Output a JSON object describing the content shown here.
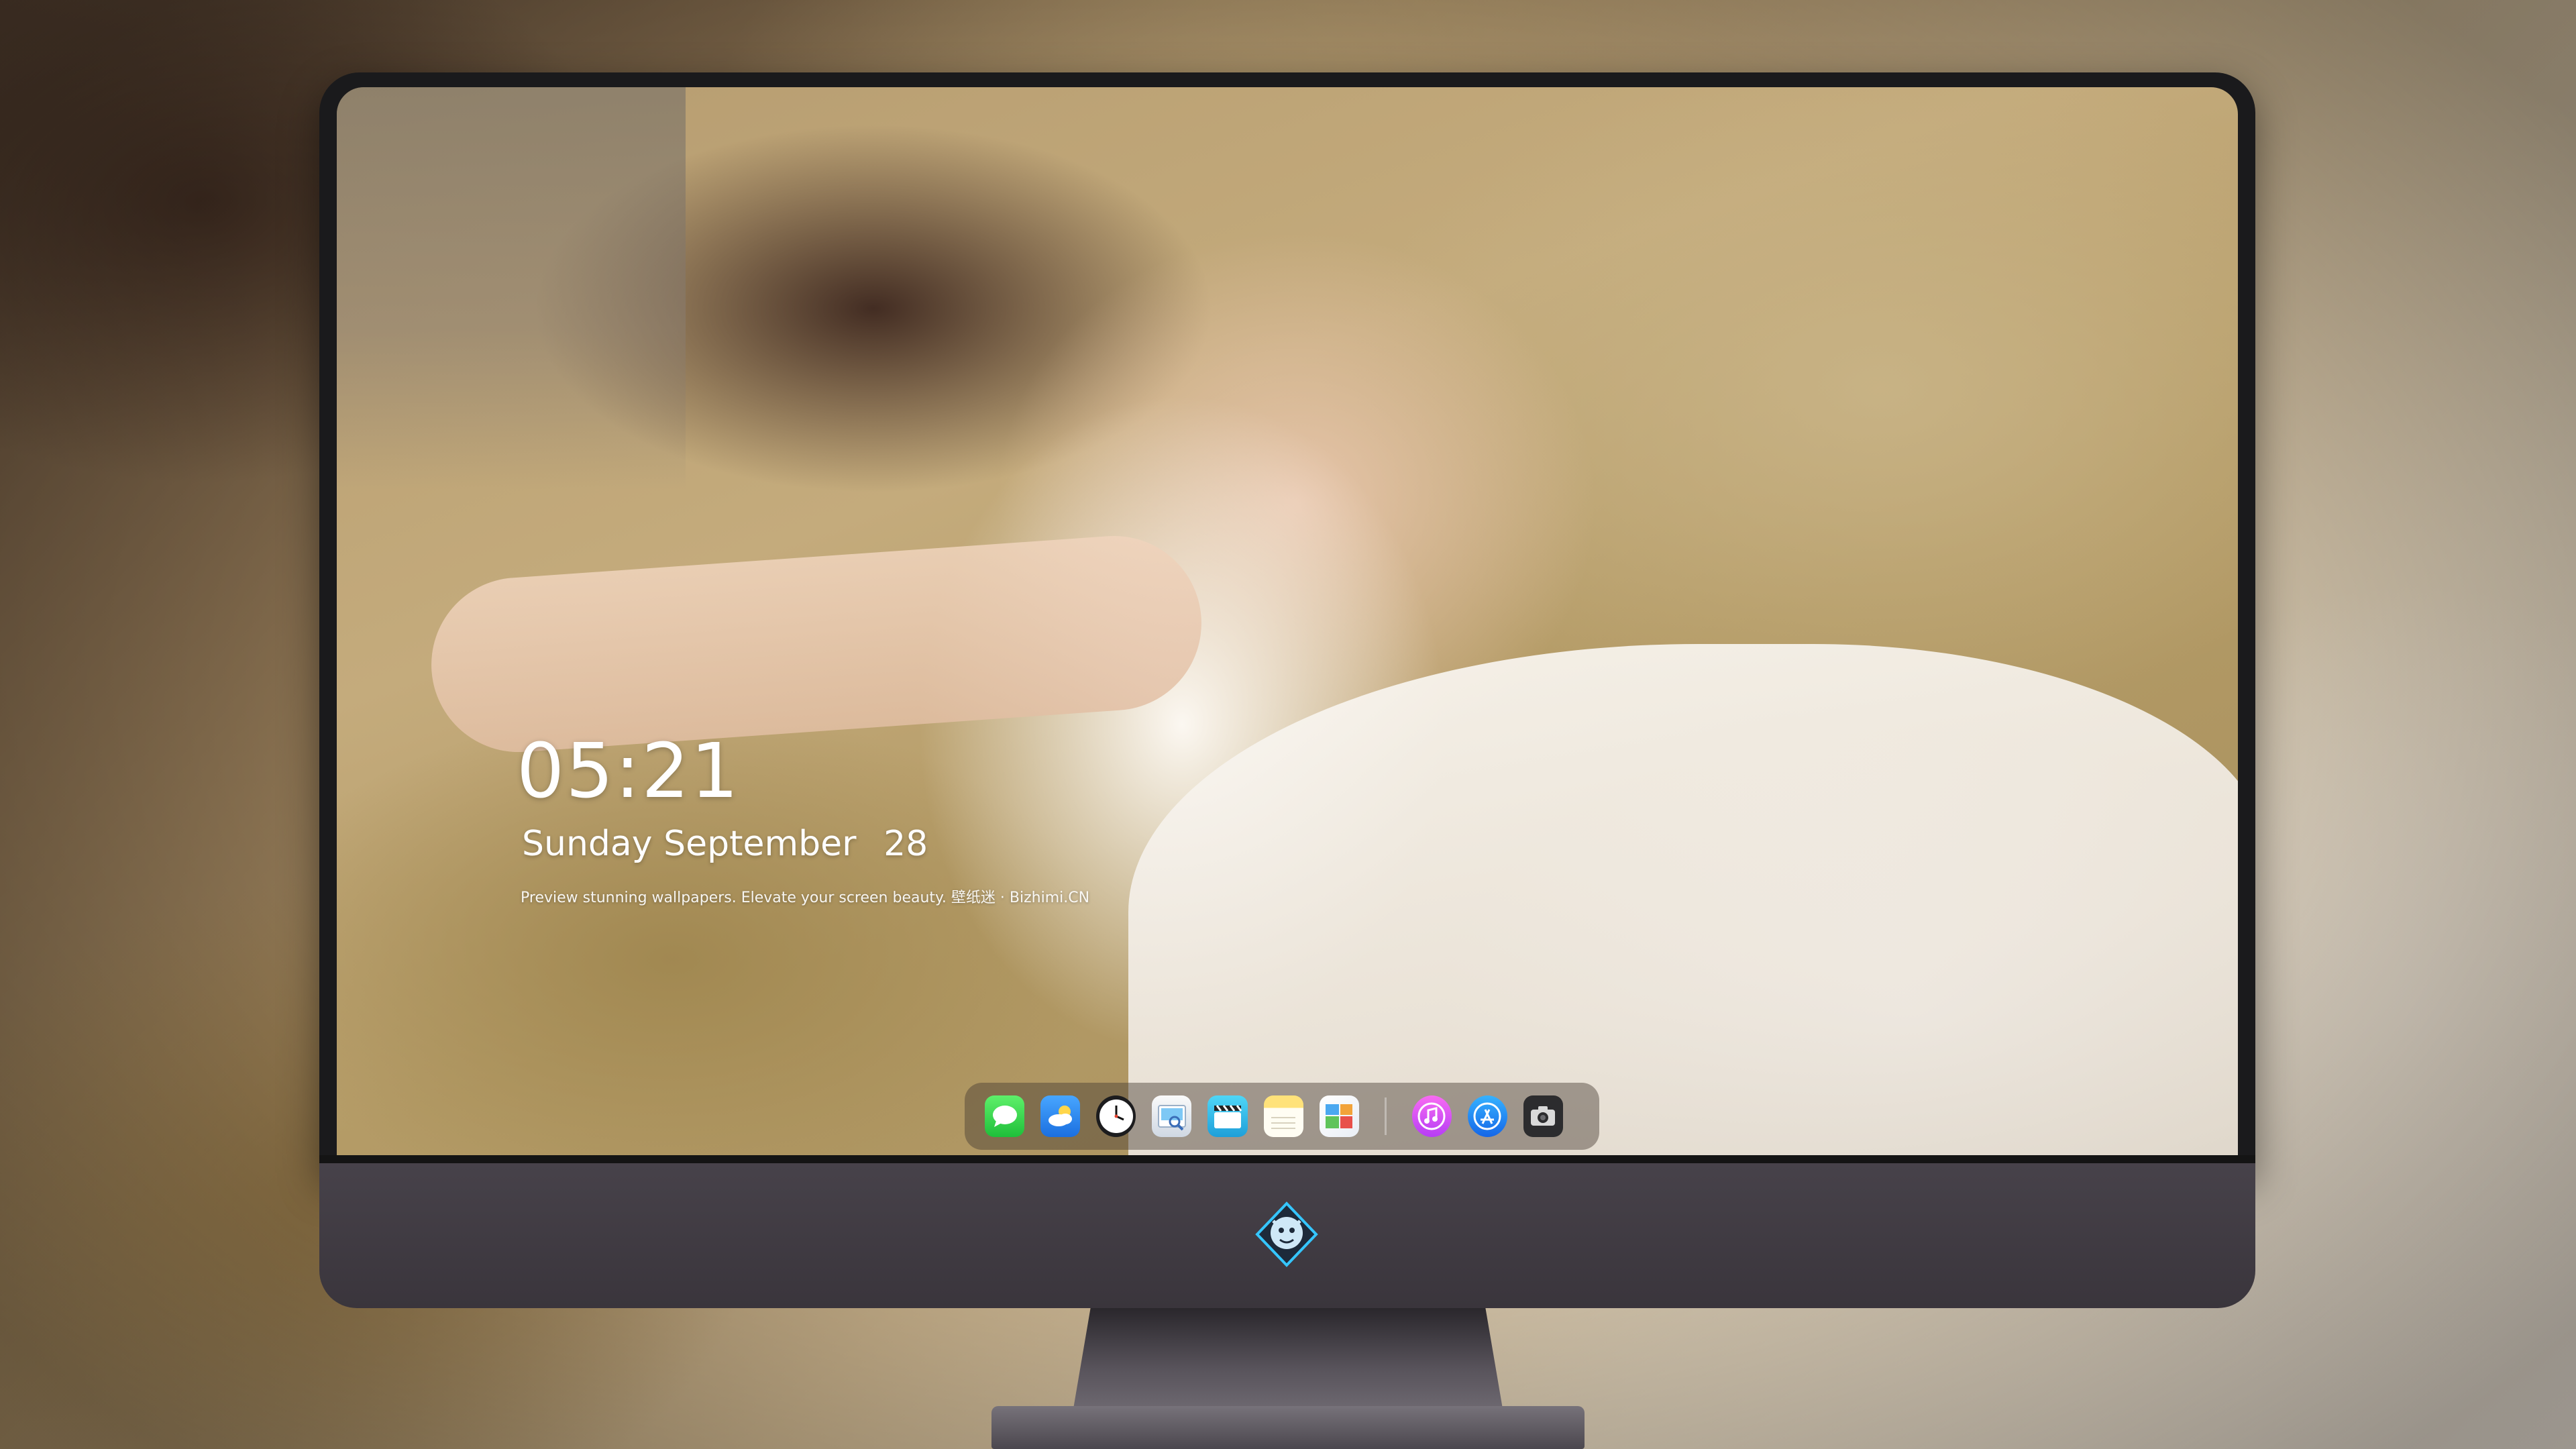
{
  "lockscreen": {
    "time": "05:21",
    "weekday": "Sunday",
    "month": "September",
    "day": "28",
    "tagline": "Preview stunning wallpapers. Elevate your screen beauty. 壁纸迷 · Bizhimi.CN"
  },
  "dock": {
    "apps": [
      {
        "name": "messages",
        "icon": "speech-bubble-icon"
      },
      {
        "name": "weather",
        "icon": "cloud-sun-icon"
      },
      {
        "name": "clock",
        "icon": "clock-icon"
      },
      {
        "name": "preview",
        "icon": "preview-icon"
      },
      {
        "name": "clips",
        "icon": "clapperboard-icon"
      },
      {
        "name": "notes",
        "icon": "notes-icon"
      },
      {
        "name": "photos",
        "icon": "photos-icon"
      },
      {
        "name": "itunes",
        "icon": "music-note-icon"
      },
      {
        "name": "app-store",
        "icon": "app-store-icon"
      },
      {
        "name": "camera",
        "icon": "camera-icon"
      }
    ]
  },
  "colors": {
    "bezel": "#1a1a1c",
    "chin": "#3f3a42",
    "dock_bg": "rgba(70,60,50,0.45)",
    "text": "#ffffff"
  }
}
